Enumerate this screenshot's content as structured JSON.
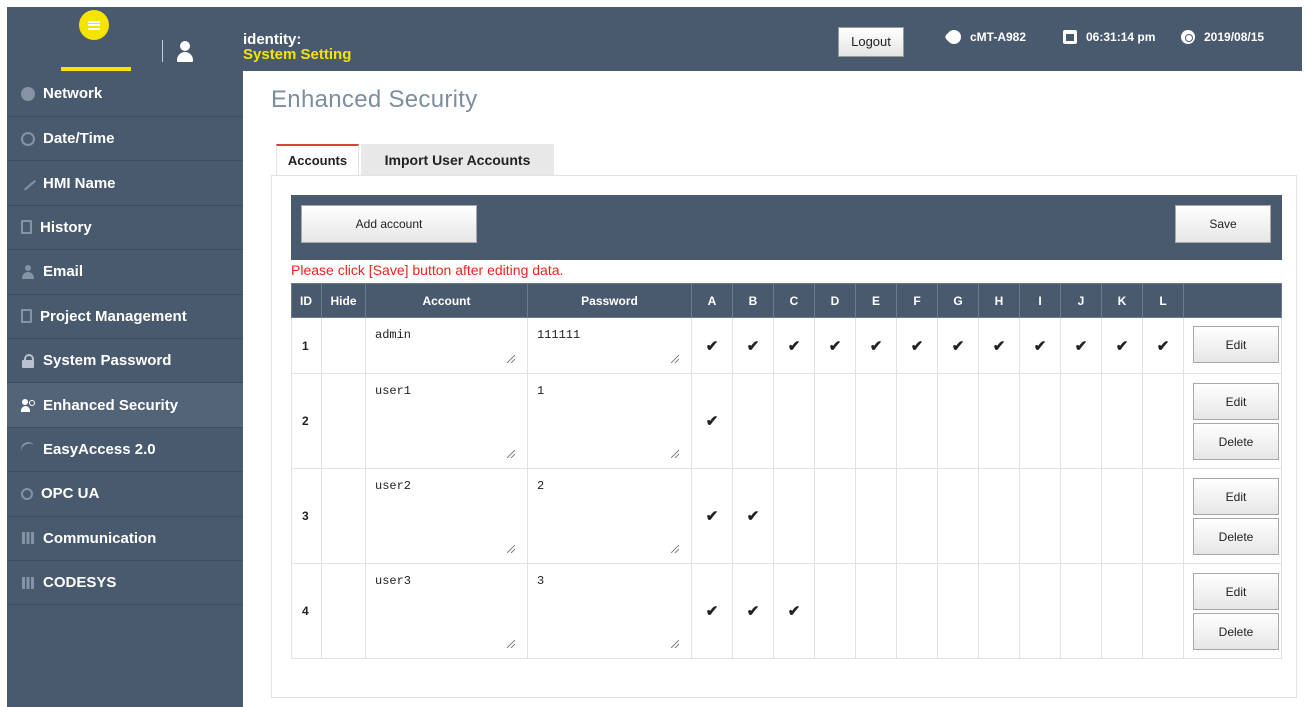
{
  "header": {
    "identity_label": "identity:",
    "identity_value": "System Setting",
    "logout_label": "Logout",
    "device": "cMT-A982",
    "time": "06:31:14 pm",
    "date": "2019/08/15",
    "accent_color": "#f5e400",
    "bar_color": "#4a5a6e"
  },
  "sidebar": {
    "items": [
      {
        "label": "Network",
        "icon": "network-ip-icon"
      },
      {
        "label": "Date/Time",
        "icon": "clock-icon"
      },
      {
        "label": "HMI Name",
        "icon": "pencil-icon"
      },
      {
        "label": "History",
        "icon": "document-icon"
      },
      {
        "label": "Email",
        "icon": "person-icon"
      },
      {
        "label": "Project Management",
        "icon": "project-icon"
      },
      {
        "label": "System Password",
        "icon": "lock-icon"
      },
      {
        "label": "Enhanced Security",
        "icon": "users-icon"
      },
      {
        "label": "EasyAccess 2.0",
        "icon": "easyaccess-icon"
      },
      {
        "label": "OPC UA",
        "icon": "opcua-icon"
      },
      {
        "label": "Communication",
        "icon": "bars-icon"
      },
      {
        "label": "CODESYS",
        "icon": "bars-icon"
      }
    ],
    "active": "Enhanced Security"
  },
  "page": {
    "title": "Enhanced Security",
    "tabs": [
      {
        "label": "Accounts",
        "active": true
      },
      {
        "label": "Import User Accounts",
        "active": false
      }
    ],
    "add_account_label": "Add account",
    "save_label": "Save",
    "hint": "Please click [Save] button after editing data.",
    "hint_color": "#e8261e"
  },
  "table": {
    "columns": [
      "ID",
      "Hide",
      "Account",
      "Password",
      "A",
      "B",
      "C",
      "D",
      "E",
      "F",
      "G",
      "H",
      "I",
      "J",
      "K",
      "L"
    ],
    "edit_label": "Edit",
    "delete_label": "Delete",
    "check_glyph": "✔",
    "rows": [
      {
        "id": "1",
        "account": "admin",
        "password": "111111",
        "perms": [
          "A",
          "B",
          "C",
          "D",
          "E",
          "F",
          "G",
          "H",
          "I",
          "J",
          "K",
          "L"
        ],
        "deletable": false
      },
      {
        "id": "2",
        "account": "user1",
        "password": "1",
        "perms": [
          "A"
        ],
        "deletable": true
      },
      {
        "id": "3",
        "account": "user2",
        "password": "2",
        "perms": [
          "A",
          "B"
        ],
        "deletable": true
      },
      {
        "id": "4",
        "account": "user3",
        "password": "3",
        "perms": [
          "A",
          "B",
          "C"
        ],
        "deletable": true
      }
    ]
  }
}
